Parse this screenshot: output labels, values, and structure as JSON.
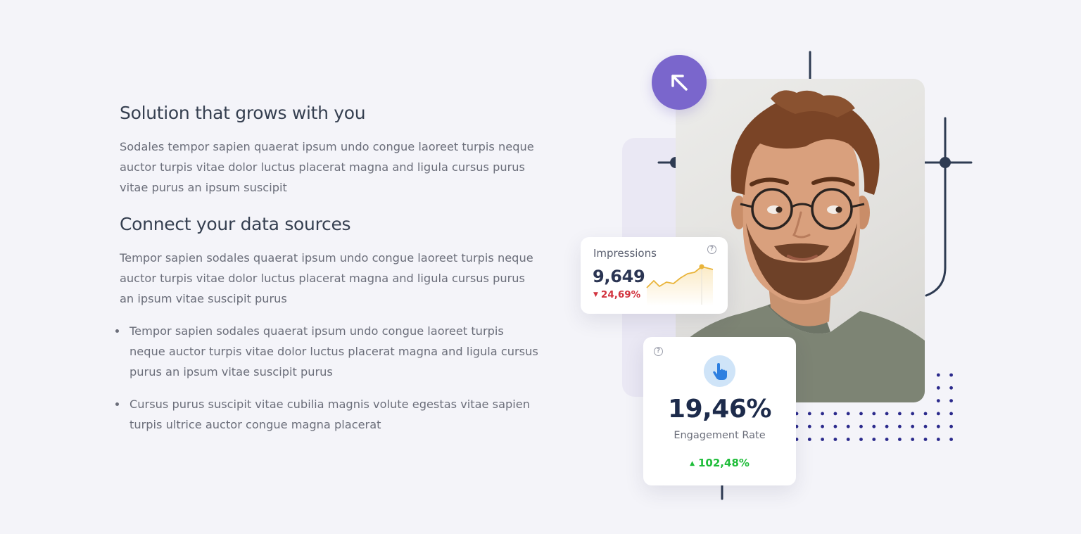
{
  "section1": {
    "heading": "Solution that grows with you",
    "paragraph": "Sodales tempor sapien quaerat ipsum undo congue laoreet turpis neque auctor turpis vitae dolor luctus placerat magna and ligula cursus purus vitae purus an ipsum suscipit"
  },
  "section2": {
    "heading": "Connect your data sources",
    "paragraph": "Tempor sapien sodales quaerat ipsum undo congue laoreet turpis neque auctor turpis vitae dolor luctus placerat magna and ligula cursus purus an ipsum vitae suscipit purus",
    "bullets": [
      "Tempor sapien sodales quaerat ipsum undo congue laoreet turpis neque auctor turpis vitae dolor luctus placerat magna and ligula cursus purus an ipsum vitae suscipit purus",
      "Cursus purus suscipit vitae cubilia magnis volute egestas vitae sapien turpis ultrice auctor congue magna placerat"
    ]
  },
  "impressions_card": {
    "title": "Impressions",
    "help_glyph": "?",
    "value": "9,649",
    "change_arrow": "▼",
    "change": "24,69%",
    "change_color": "#d2343f",
    "sparkline_color": "#e9b43a"
  },
  "engagement_card": {
    "help_glyph": "?",
    "icon": "hand-pointer-icon",
    "value": "19,46%",
    "label": "Engagement Rate",
    "change_arrow": "▲",
    "change": "102,48%",
    "change_color": "#1fbd3a"
  },
  "colors": {
    "accent_purple": "#7a66cc",
    "dots": "#2b2a8c",
    "lines": "#2e3b52",
    "background": "#f4f4f9"
  }
}
